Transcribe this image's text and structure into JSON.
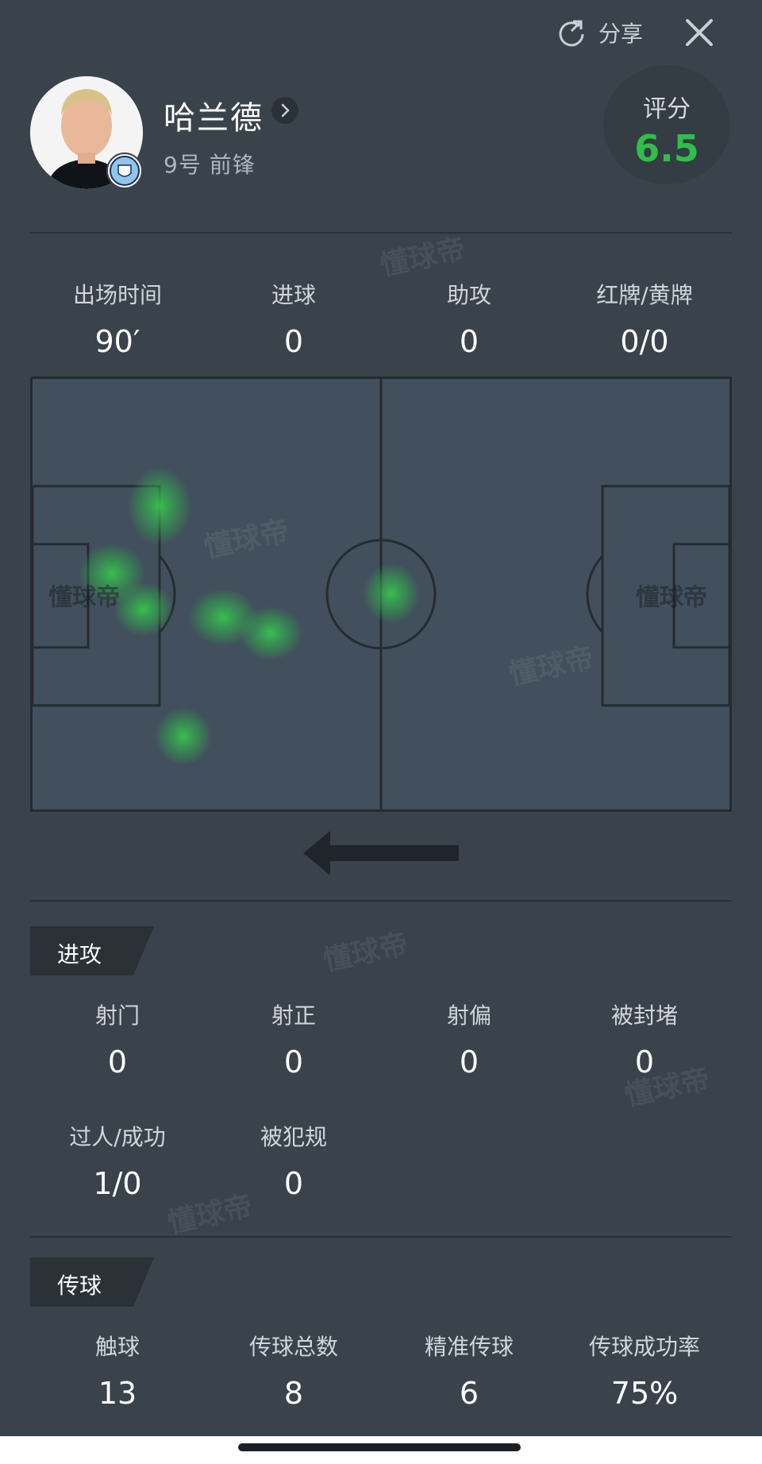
{
  "header": {
    "share_label": "分享",
    "share_icon": "share-icon",
    "close_icon": "close-icon"
  },
  "player": {
    "name": "哈兰德",
    "meta": "9号 前锋",
    "rating_label": "评分",
    "rating_value": "6.5",
    "rating_color": "#2fbf4a"
  },
  "summary": [
    {
      "label": "出场时间",
      "value": "90′"
    },
    {
      "label": "进球",
      "value": "0"
    },
    {
      "label": "助攻",
      "value": "0"
    },
    {
      "label": "红牌/黄牌",
      "value": "0/0"
    }
  ],
  "heatmap": {
    "direction_icon": "arrow-left-icon",
    "watermark": "懂球帝"
  },
  "attack": {
    "title": "进攻",
    "row1": [
      {
        "label": "射门",
        "value": "0"
      },
      {
        "label": "射正",
        "value": "0"
      },
      {
        "label": "射偏",
        "value": "0"
      },
      {
        "label": "被封堵",
        "value": "0"
      }
    ],
    "row2": [
      {
        "label": "过人/成功",
        "value": "1/0"
      },
      {
        "label": "被犯规",
        "value": "0"
      }
    ]
  },
  "passing": {
    "title": "传球",
    "row1": [
      {
        "label": "触球",
        "value": "13"
      },
      {
        "label": "传球总数",
        "value": "8"
      },
      {
        "label": "精准传球",
        "value": "6"
      },
      {
        "label": "传球成功率",
        "value": "75%"
      }
    ]
  }
}
